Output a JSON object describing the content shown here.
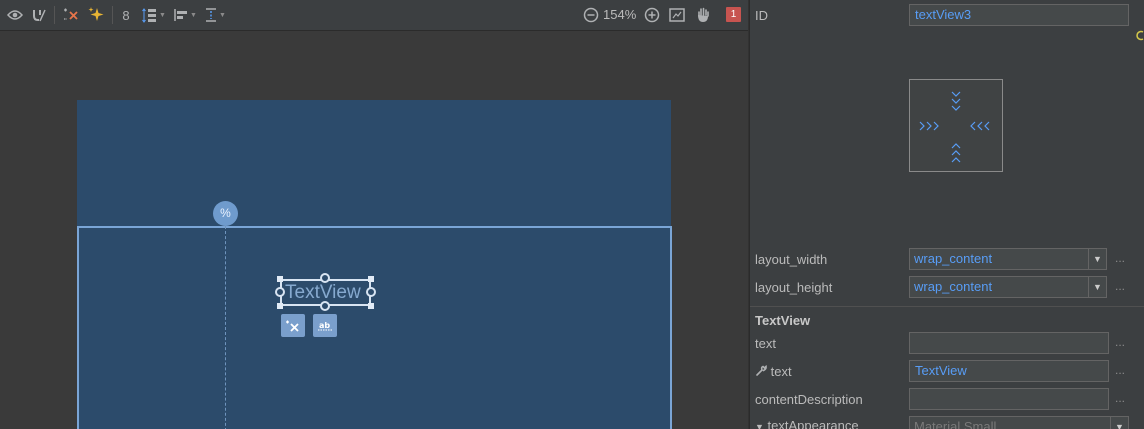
{
  "toolbar": {
    "icons": [
      "eye-icon",
      "magnet-icon",
      "clear-constraints-icon",
      "infer-constraints-icon",
      "default-margin",
      "pack-icon",
      "align-icon",
      "guidelines-icon",
      "zoom-out-icon",
      "zoom-in-icon",
      "fit-screen-icon",
      "pan-icon"
    ],
    "default_margin": "8",
    "zoom_level": "154%",
    "warning_count": "1"
  },
  "canvas": {
    "guideline_handle": "%",
    "textview_label": "TextView",
    "colors": {
      "blueprint_bg": "#2c4b6b",
      "selection": "#d8e4f2",
      "border": "#7aa5d6"
    }
  },
  "attributes": {
    "id_label": "ID",
    "id_value": "textView3",
    "layout_width_label": "layout_width",
    "layout_width_value": "wrap_content",
    "layout_height_label": "layout_height",
    "layout_height_value": "wrap_content",
    "section_title": "TextView",
    "text_label": "text",
    "text_value": "",
    "tools_text_label": "text",
    "tools_text_value": "TextView",
    "content_description_label": "contentDescription",
    "content_description_value": "",
    "text_appearance_label": "textAppearance",
    "text_appearance_value": "Material.Small",
    "more": "..."
  },
  "colors": {
    "accent": "#589df6",
    "panel_bg": "#3c3f41",
    "warning": "#c75450"
  }
}
